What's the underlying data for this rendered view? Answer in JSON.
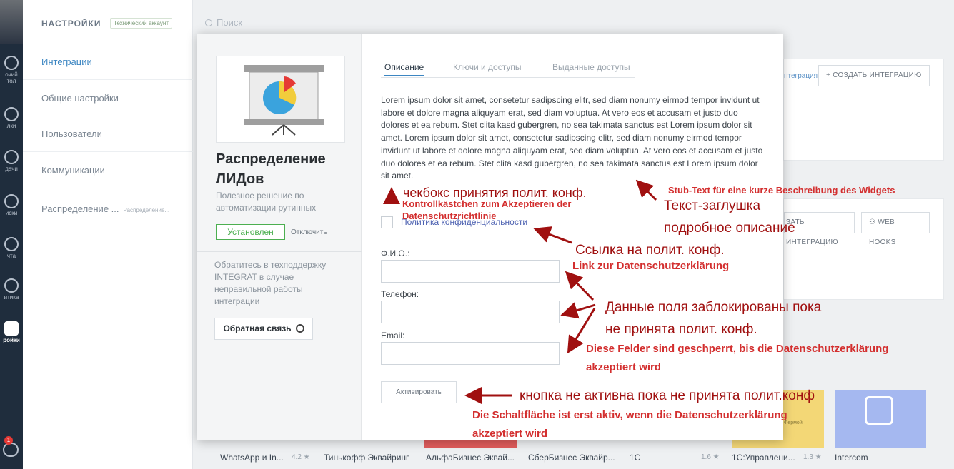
{
  "rail": {
    "items": [
      {
        "label": "очий\nтол",
        "icon": "desktop-icon"
      },
      {
        "label": "лки",
        "icon": "deals-icon"
      },
      {
        "label": "дачи",
        "icon": "tasks-icon"
      },
      {
        "label": "иски",
        "icon": "lists-icon"
      },
      {
        "label": "чта",
        "icon": "mail-icon"
      },
      {
        "label": "итика",
        "icon": "analytics-icon"
      },
      {
        "label": "ройки",
        "icon": "settings-wrench-icon"
      }
    ],
    "chat_badge": "1"
  },
  "settings": {
    "title": "НАСТРОЙКИ",
    "account_badge": "Технический аккаунт",
    "menu": [
      {
        "label": "Интеграции"
      },
      {
        "label": "Общие настройки"
      },
      {
        "label": "Пользователи"
      },
      {
        "label": "Коммуникации"
      },
      {
        "label": "Распределение ...",
        "sub": "Распределение..."
      }
    ]
  },
  "search": {
    "placeholder": "Поиск"
  },
  "background": {
    "link_text": "нтеграция",
    "create_btn": "+ СОЗДАТЬ ИНТЕГРАЦИЮ",
    "create_btn2": "ЗАТЬ ИНТЕГРАЦИЮ",
    "webhooks_btn": "WEB HOOKS",
    "tiles": [
      {
        "name": "WhatsApp и In...",
        "rating": "4.2 ★"
      },
      {
        "name": "Тинькофф Эквайринг",
        "rating": ""
      },
      {
        "name": "АльфаБизнес Эквай...",
        "rating": ""
      },
      {
        "name": "СберБизнес Эквайр...",
        "rating": ""
      },
      {
        "name": "1С",
        "rating": "1.6 ★"
      },
      {
        "name": "1С:Управлени...",
        "rating": "1.3 ★"
      },
      {
        "name": "Intercom",
        "rating": ""
      }
    ],
    "tile_colors": [
      "#e05b5b",
      "#f3d776",
      "#a5b8f0"
    ],
    "tile_small_text": "Фермой"
  },
  "modal": {
    "app_name": "Распределение ЛИДов",
    "app_desc": "Полезное решение по автоматизации рутинных",
    "installed_label": "Установлен",
    "disable_label": "Отключить",
    "support_text": "Обратитесь в техподдержку INTEGRAT в случае неправильной работы интеграции",
    "feedback_label": "Обратная связь",
    "tabs": [
      "Описание",
      "Ключи и доступы",
      "Выданные доступы"
    ],
    "lorem": "Lorem ipsum dolor sit amet, consetetur sadipscing elitr, sed diam nonumy eirmod tempor invidunt ut labore et dolore magna aliquyam erat, sed diam voluptua. At vero eos et accusam et justo duo dolores et ea rebum. Stet clita kasd gubergren, no sea takimata sanctus est Lorem ipsum dolor sit amet. Lorem ipsum dolor sit amet, consetetur sadipscing elitr, sed diam nonumy eirmod tempor invidunt ut labore et dolore magna aliquyam erat, sed diam voluptua. At vero eos et accusam et justo duo dolores et ea rebum. Stet clita kasd gubergren, no sea takimata sanctus est Lorem ipsum dolor sit amet.",
    "policy_link": "Политика конфиденциальности",
    "fields": [
      {
        "label": "Ф.И.О.:",
        "value": ""
      },
      {
        "label": "Телефон:",
        "value": ""
      },
      {
        "label": "Email:",
        "value": ""
      }
    ],
    "activate_label": "Активировать"
  },
  "annotations": {
    "checkbox_ru": "чекбокс принятия полит. конф.",
    "checkbox_de": "Kontrollkästchen zum Akzeptieren der Datenschutzrichtlinie",
    "stub_de": "Stub-Text für eine kurze Beschreibung des Widgets",
    "stub_ru_1": "Текст-заглушка",
    "stub_ru_2": "подробное описание",
    "link_ru": "Ссылка на полит. конф.",
    "link_de": "Link zur Datenschutzerklärung",
    "fields_ru_1": "Данные поля заблокированы пока",
    "fields_ru_2": "не принята полит. конф.",
    "fields_de_1": "Diese Felder sind geschperrt, bis die Datenschutzerklärung",
    "fields_de_2": "akzeptiert wird",
    "button_ru": "кнопка не активна пока не принята полит.конф",
    "button_de_1": "Die Schaltfläche ist erst aktiv, wenn die Datenschutzerklärung",
    "button_de_2": "akzeptiert wird"
  }
}
